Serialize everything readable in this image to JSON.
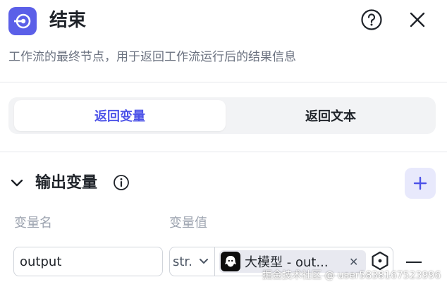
{
  "header": {
    "title": "结束",
    "description": "工作流的最终节点，用于返回工作流运行后的结果信息"
  },
  "tabs": [
    {
      "label": "返回变量",
      "active": true
    },
    {
      "label": "返回文本",
      "active": false
    }
  ],
  "output_section": {
    "title": "输出变量",
    "col_name_header": "变量名",
    "col_value_header": "变量值",
    "rows": [
      {
        "name": "output",
        "type": "str.",
        "ref_label": "大模型 - output",
        "ref_label_display": "大模型 - out..."
      }
    ]
  },
  "watermark": "掘金技术社区 @ user5838167523996",
  "colors": {
    "accent": "#4d53e8",
    "node_icon_bg": "#5b5fe8",
    "add_btn_bg": "#e8e9fc"
  }
}
